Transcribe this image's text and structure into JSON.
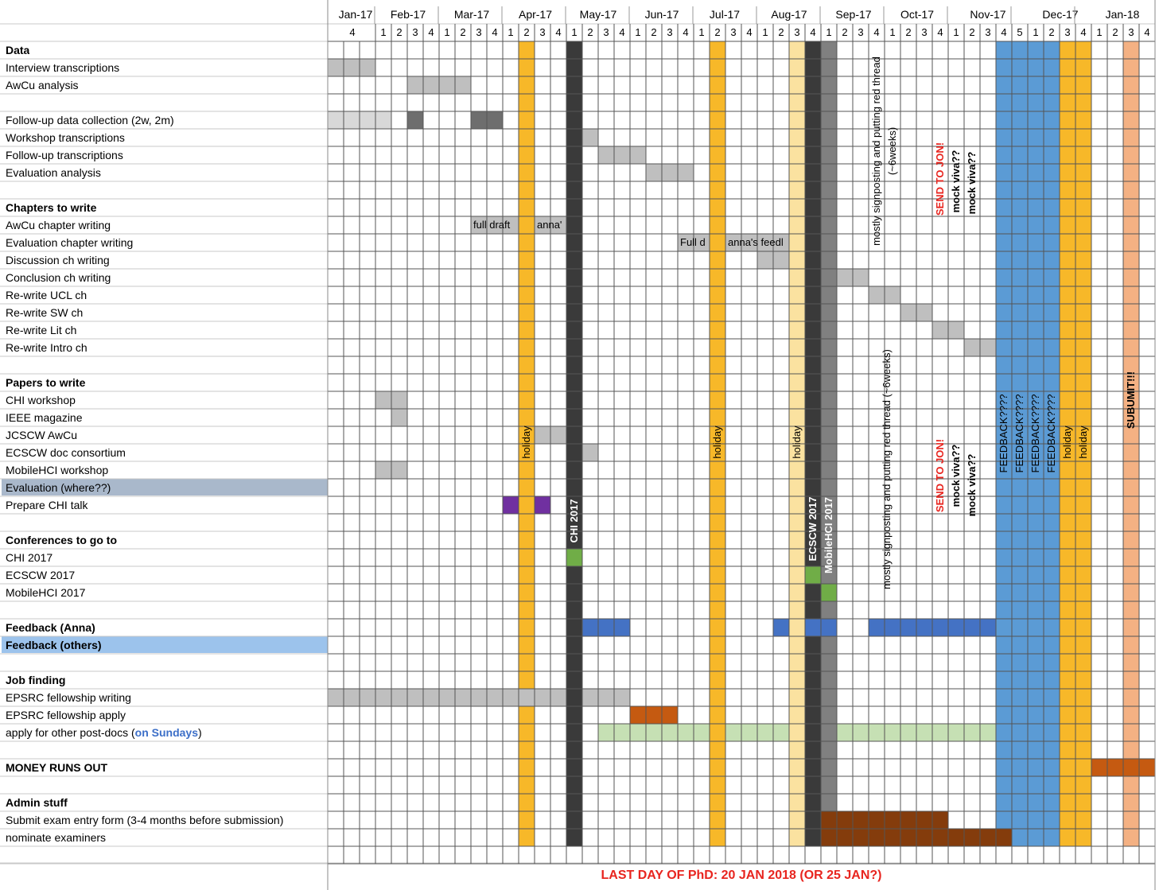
{
  "months": [
    "Jan-17",
    "Feb-17",
    "Mar-17",
    "Apr-17",
    "May-17",
    "Jun-17",
    "Jul-17",
    "Aug-17",
    "Sep-17",
    "Oct-17",
    "Nov-17",
    "Dec-17",
    "Jan-18"
  ],
  "week_numbers": [
    "4",
    "1",
    "2",
    "3",
    "4",
    "1",
    "2",
    "3",
    "4",
    "1",
    "2",
    "3",
    "4",
    "1",
    "2",
    "3",
    "4",
    "1",
    "2",
    "3",
    "4",
    "1",
    "2",
    "3",
    "4",
    "1",
    "2",
    "3",
    "4",
    "1",
    "2",
    "3",
    "4",
    "1",
    "2",
    "3",
    "4",
    "1",
    "2",
    "3",
    "4",
    "5",
    "1",
    "2",
    "3",
    "4",
    "1",
    "2",
    "3",
    "4"
  ],
  "rows": [
    {
      "label": "Data",
      "bold": true
    },
    {
      "label": "Interview transcriptions"
    },
    {
      "label": "AwCu analysis"
    },
    {
      "label": ""
    },
    {
      "label": "Follow-up data collection (2w, 2m)"
    },
    {
      "label": "Workshop transcriptions"
    },
    {
      "label": "Follow-up transcriptions"
    },
    {
      "label": "Evaluation analysis"
    },
    {
      "label": ""
    },
    {
      "label": "Chapters to write",
      "bold": true
    },
    {
      "label": "AwCu chapter writing"
    },
    {
      "label": "Evaluation chapter writing"
    },
    {
      "label": "Discussion ch writing"
    },
    {
      "label": "Conclusion ch writing"
    },
    {
      "label": "Re-write UCL ch"
    },
    {
      "label": "Re-write SW ch"
    },
    {
      "label": "Re-write Lit ch"
    },
    {
      "label": "Re-write Intro ch"
    },
    {
      "label": ""
    },
    {
      "label": "Papers to write",
      "bold": true
    },
    {
      "label": "CHI workshop"
    },
    {
      "label": "IEEE magazine"
    },
    {
      "label": "JCSCW AwCu"
    },
    {
      "label": "ECSCW doc consortium"
    },
    {
      "label": "MobileHCI workshop"
    },
    {
      "label": "Evaluation (where??)",
      "highlight": "#a9b8cb"
    },
    {
      "label": "Prepare CHI talk"
    },
    {
      "label": ""
    },
    {
      "label": "Conferences to go to",
      "bold": true
    },
    {
      "label": "CHI 2017"
    },
    {
      "label": "ECSCW 2017"
    },
    {
      "label": "MobileHCI 2017"
    },
    {
      "label": ""
    },
    {
      "label": "Feedback (Anna)",
      "bold": true
    },
    {
      "label": "Feedback (others)",
      "bold": true,
      "highlight": "#9cc3ec"
    },
    {
      "label": ""
    },
    {
      "label": "Job finding",
      "bold": true
    },
    {
      "label": "EPSRC fellowship writing"
    },
    {
      "label": "EPSRC fellowship apply"
    },
    {
      "label": "apply for other post-docs (",
      "suffix": "on Sundays",
      ")": ")"
    },
    {
      "label": ""
    },
    {
      "label": "MONEY RUNS OUT",
      "bold": true
    },
    {
      "label": ""
    },
    {
      "label": "Admin stuff",
      "bold": true
    },
    {
      "label": "Submit exam entry form (3-4 months before submission)"
    },
    {
      "label": "nominate examiners"
    }
  ],
  "cell_notes": {
    "full_draft": "full draft",
    "anna_1": "anna'",
    "full_d": "Full d",
    "anna_feedb": "anna's feedl"
  },
  "vertical_notes": {
    "holiday": "holiday",
    "chi": "CHI 2017",
    "ecscw": "ECSCW 2017",
    "mobilehci": "MobileHCI 2017",
    "signposting": "mostly signposting and putting red thread",
    "signposting_2": "(~6weeks)",
    "signposting_full": "mostly signposting and putting red thread (~6weeks)",
    "send_jon": "SEND TO JON!",
    "mock_viva": "mock viva??",
    "feedback": "FEEDBACK????",
    "submit": "SUBUMIT!!!"
  },
  "footer": "LAST DAY OF PhD: 20 JAN 2018 (OR 25 JAN?)",
  "colors": {
    "grey_light": "#d8d8d8",
    "grey_mid": "#bfbfbf",
    "grey_dark": "#808080",
    "grey_darker": "#6e6e6e",
    "charcoal": "#3a3a3a",
    "orange": "#f7b829",
    "orange_light": "#fbe2a0",
    "purple": "#7030a0",
    "green": "#70ad47",
    "blue": "#4472c4",
    "blue_big": "#5b9bd5",
    "rust": "#c55a11",
    "brown": "#843c0c",
    "pale_green": "#c6e0b4",
    "salmon": "#f4b183",
    "red": "#e8251f"
  }
}
